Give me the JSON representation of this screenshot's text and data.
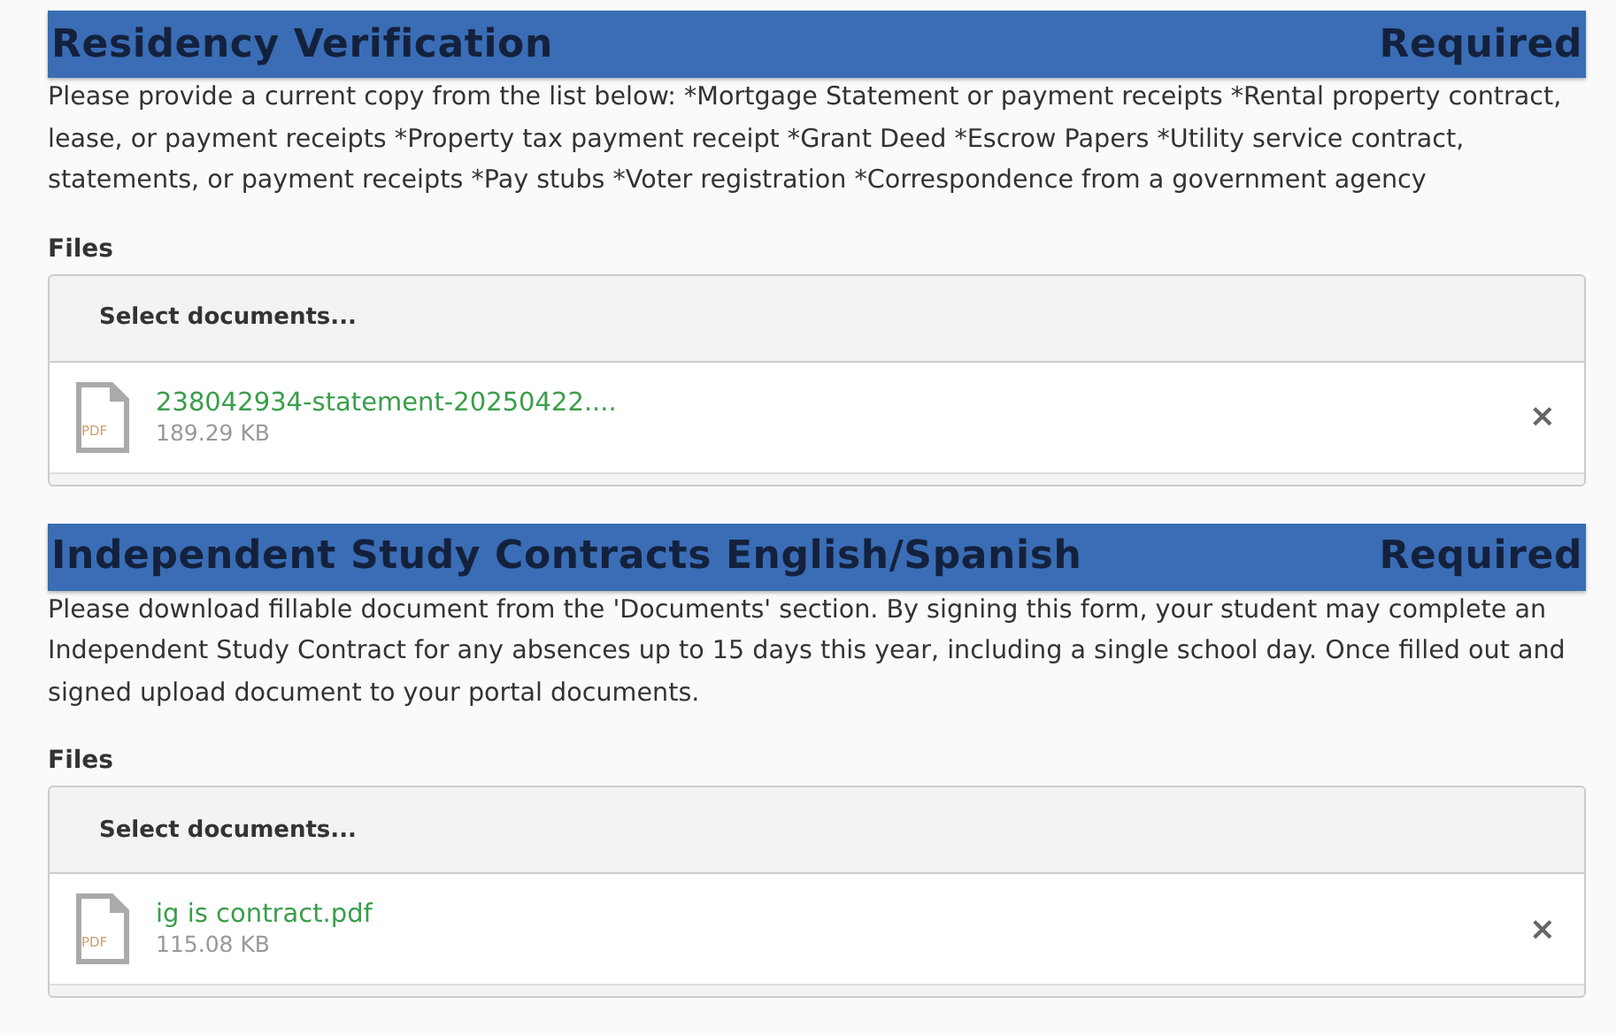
{
  "sections": [
    {
      "title": "Residency Verification",
      "requirement": "Required",
      "description": "Please provide a current copy from the list below: *Mortgage Statement or payment receipts *Rental property contract, lease, or payment receipts *Property tax payment receipt *Grant Deed *Escrow Papers *Utility service contract, statements, or payment receipts *Pay stubs *Voter registration *Correspondence from a government agency",
      "files_label": "Files",
      "select_button": "Select documents...",
      "files": [
        {
          "name": "238042934-statement-20250422....",
          "size": "189.29 KB",
          "type_label": "PDF",
          "remove": "×"
        }
      ]
    },
    {
      "title": "Independent Study Contracts English/Spanish",
      "requirement": "Required",
      "description": "Please download fillable document from the 'Documents' section. By signing this form, your student may complete an Independent Study Contract for any absences up to 15 days this year, including a single school day. Once filled out and signed upload document to your portal documents.",
      "files_label": "Files",
      "select_button": "Select documents...",
      "files": [
        {
          "name": "ig is contract.pdf",
          "size": "115.08 KB",
          "type_label": "PDF",
          "remove": "×"
        }
      ]
    }
  ]
}
